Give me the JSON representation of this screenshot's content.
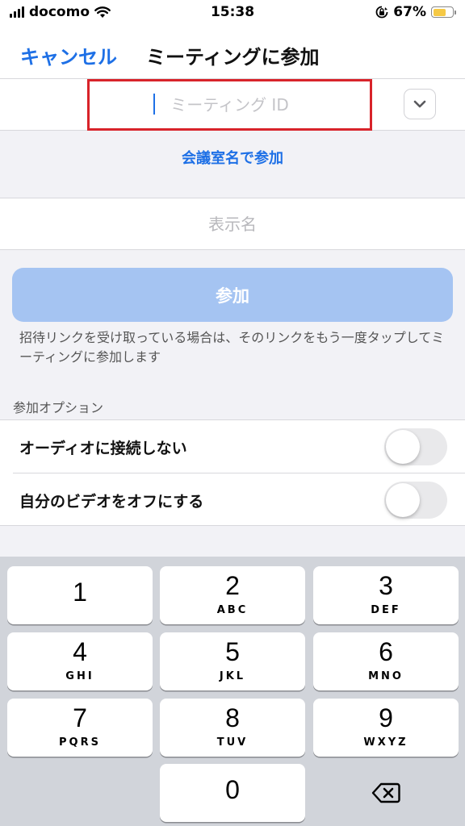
{
  "status_bar": {
    "carrier": "docomo",
    "time": "15:38",
    "battery_percent": "67%",
    "battery_level": 0.67,
    "icons": [
      "signal-icon",
      "wifi-icon",
      "orientation-lock-icon",
      "battery-icon"
    ]
  },
  "nav": {
    "cancel_label": "キャンセル",
    "title": "ミーティングに参加"
  },
  "meeting_id": {
    "value": "",
    "placeholder": "ミーティング ID",
    "dropdown_icon": "chevron-down-icon"
  },
  "room_link_label": "会議室名で参加",
  "display_name": {
    "value": "",
    "placeholder": "表示名"
  },
  "join_button_label": "参加",
  "help_text": "招待リンクを受け取っている場合は、そのリンクをもう一度タップしてミーティングに参加します",
  "options_header": "参加オプション",
  "options": [
    {
      "label": "オーディオに接続しない",
      "on": false
    },
    {
      "label": "自分のビデオをオフにする",
      "on": false
    }
  ],
  "keypad": {
    "keys": [
      {
        "digit": "1",
        "letters": ""
      },
      {
        "digit": "2",
        "letters": "ABC"
      },
      {
        "digit": "3",
        "letters": "DEF"
      },
      {
        "digit": "4",
        "letters": "GHI"
      },
      {
        "digit": "5",
        "letters": "JKL"
      },
      {
        "digit": "6",
        "letters": "MNO"
      },
      {
        "digit": "7",
        "letters": "PQRS"
      },
      {
        "digit": "8",
        "letters": "TUV"
      },
      {
        "digit": "9",
        "letters": "WXYZ"
      },
      {
        "digit": "0",
        "letters": ""
      }
    ],
    "delete_icon": "backspace-icon"
  },
  "colors": {
    "accent": "#1e70e6",
    "highlight_border": "#d8232a",
    "join_button": "#a5c4f2",
    "toggle_off": "#e9e9eb",
    "keyboard_bg": "#d1d4da"
  }
}
